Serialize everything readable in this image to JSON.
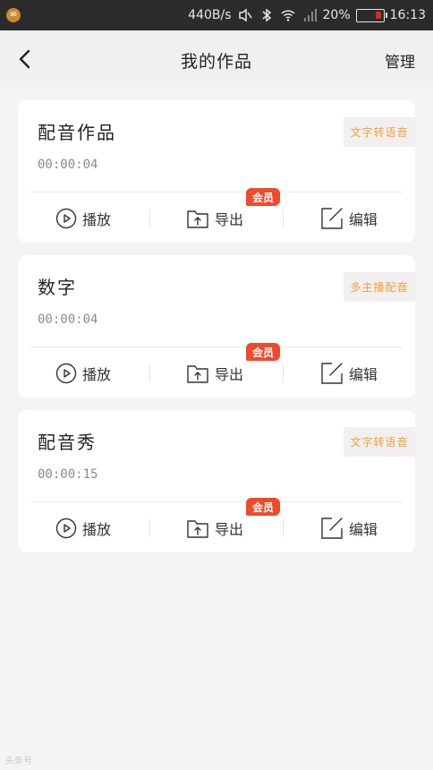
{
  "status_bar": {
    "speed": "440B/s",
    "battery_percent": "20%",
    "time": "16:13"
  },
  "navbar": {
    "title": "我的作品",
    "manage_label": "管理"
  },
  "actions": {
    "play_label": "播放",
    "export_label": "导出",
    "edit_label": "编辑",
    "vip_badge": "会员"
  },
  "works": [
    {
      "title": "配音作品",
      "duration": "00:00:04",
      "tag": "文字转语音"
    },
    {
      "title": "数字",
      "duration": "00:00:04",
      "tag": "多主播配音"
    },
    {
      "title": "配音秀",
      "duration": "00:00:15",
      "tag": "文字转语音"
    }
  ],
  "watermark": "头条号",
  "colors": {
    "accent": "#f2a03d",
    "vip_red": "#ee4b2b"
  }
}
